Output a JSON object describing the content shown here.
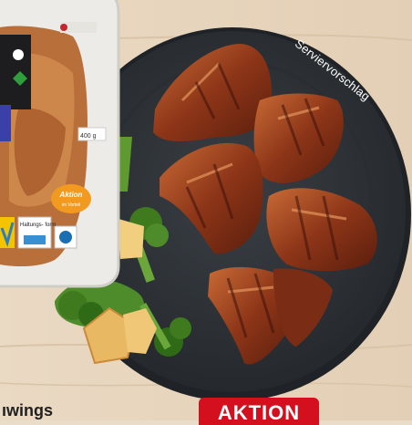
{
  "overlay": {
    "serving_suggestion": "Serviervorschlag",
    "promo_badge": "AKTION",
    "product_name_partial": "ıwings"
  },
  "package": {
    "weight": "400 g",
    "aktion_sticker_line1": "Aktion",
    "aktion_sticker_line2": "im Vorteil",
    "husbandry_label": "Haltungs-\nform"
  },
  "colors": {
    "background": "#e9dcc9",
    "plate": "#2f3338",
    "promo_red": "#d4101e",
    "sticker_orange": "#f29a1f"
  }
}
